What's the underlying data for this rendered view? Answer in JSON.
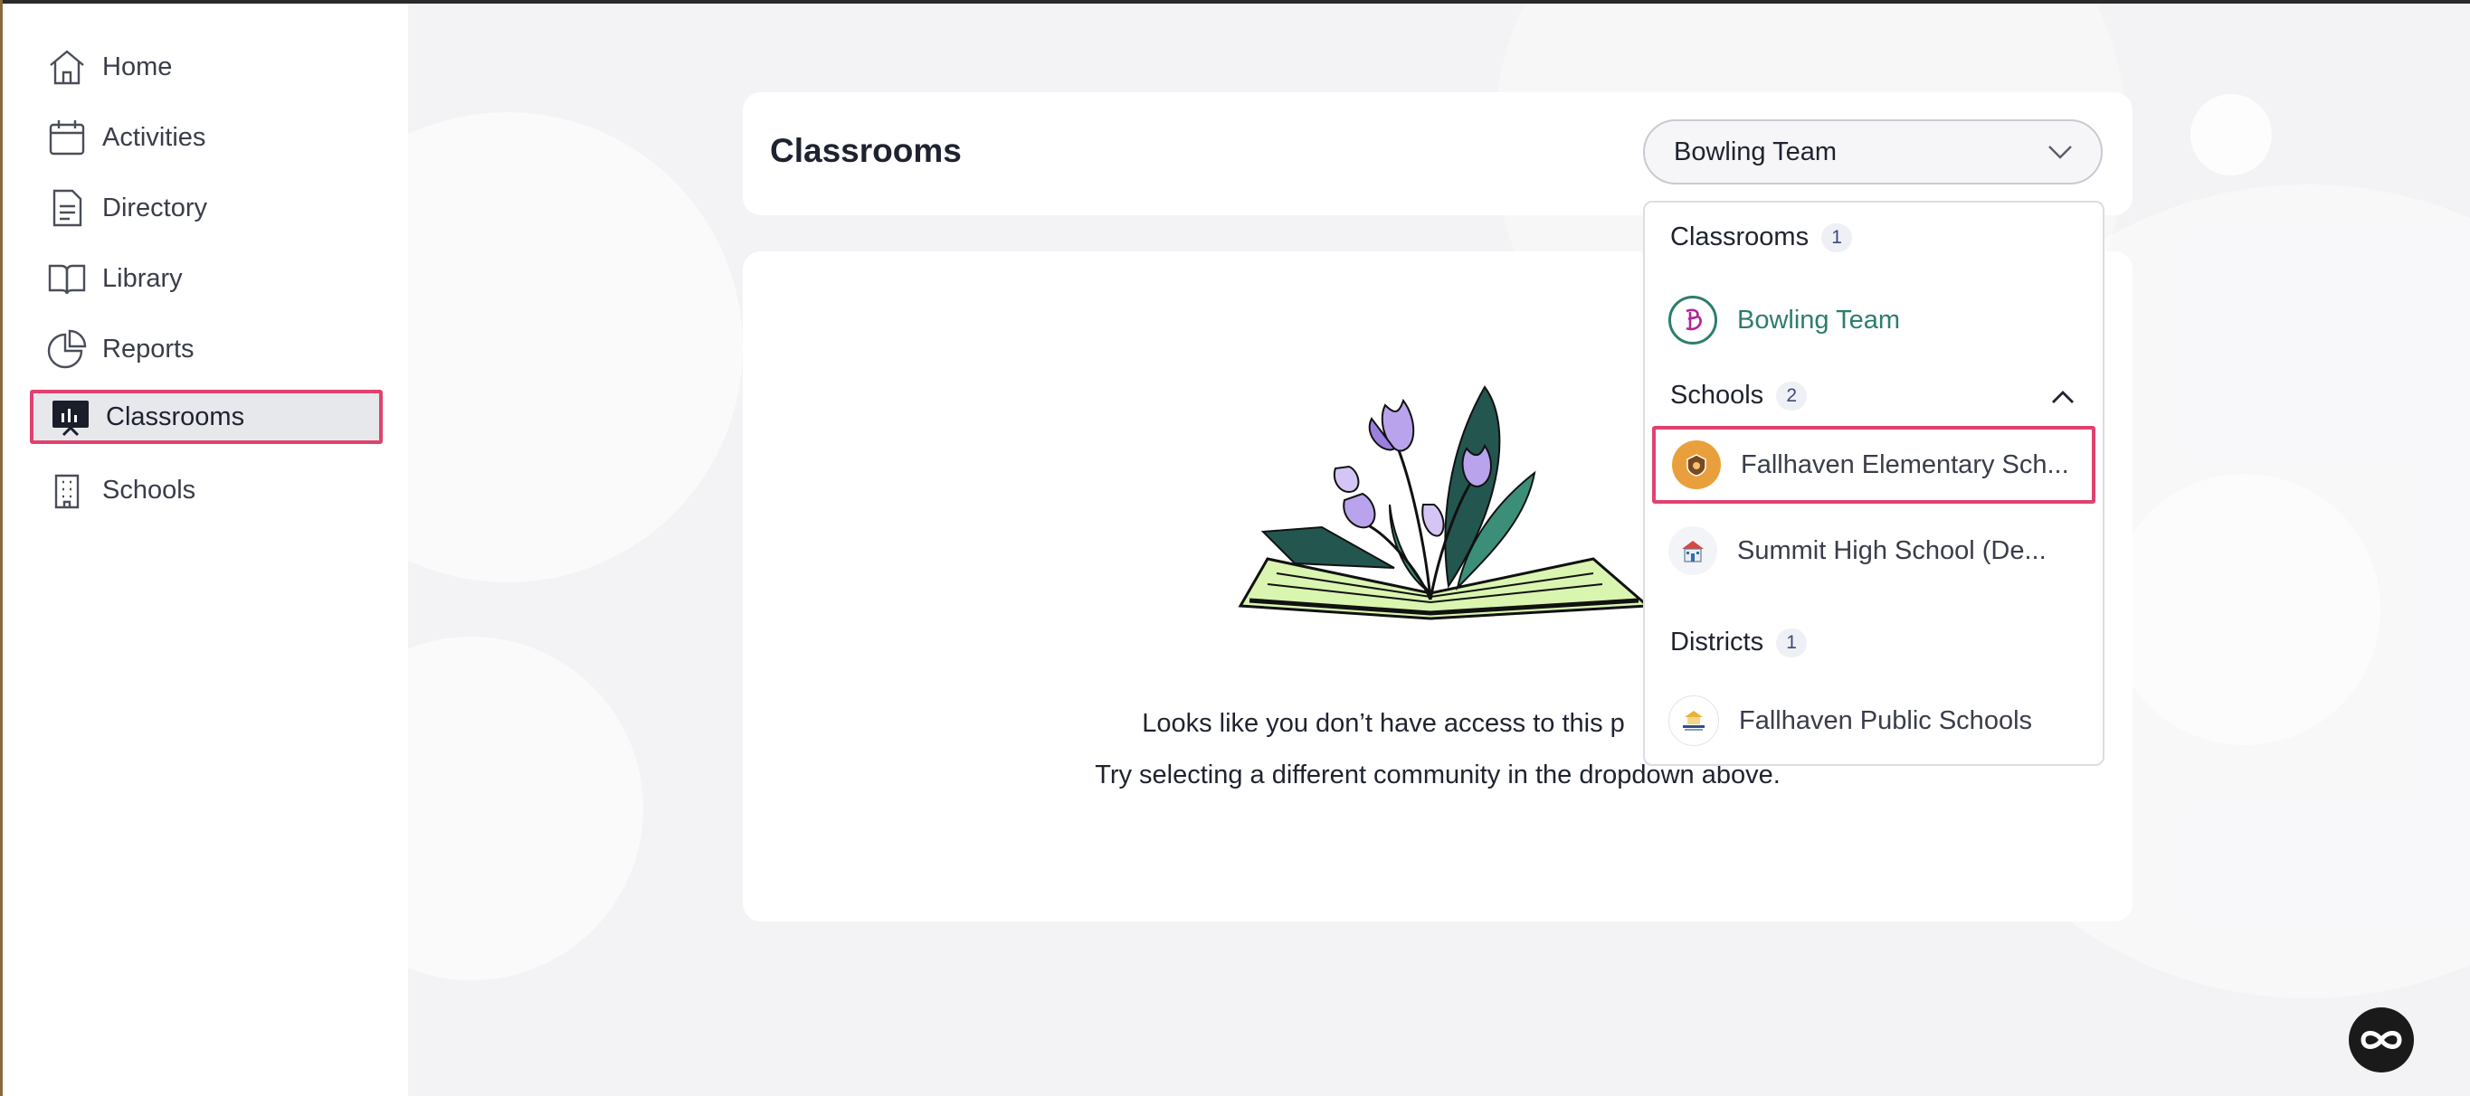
{
  "sidebar": {
    "items": [
      {
        "label": "Home",
        "icon": "home-icon"
      },
      {
        "label": "Activities",
        "icon": "calendar-icon"
      },
      {
        "label": "Directory",
        "icon": "document-icon"
      },
      {
        "label": "Library",
        "icon": "book-icon"
      },
      {
        "label": "Reports",
        "icon": "pie-chart-icon"
      },
      {
        "label": "Classrooms",
        "icon": "presentation-board-icon",
        "active": true
      },
      {
        "label": "Schools",
        "icon": "building-icon"
      }
    ]
  },
  "header": {
    "title": "Classrooms",
    "dropdown_value": "Bowling Team"
  },
  "menu": {
    "classrooms": {
      "title": "Classrooms",
      "count": "1",
      "items": [
        "Bowling Team"
      ]
    },
    "schools": {
      "title": "Schools",
      "count": "2",
      "items": [
        "Fallhaven Elementary Sch...",
        "Summit High School (De..."
      ]
    },
    "districts": {
      "title": "Districts",
      "count": "1",
      "items": [
        "Fallhaven Public Schools"
      ]
    }
  },
  "content": {
    "message_line1": "Looks like you don’t have access to this p",
    "message_line2": "Try selecting a different community in the dropdown above."
  },
  "colors": {
    "accent_highlight": "#e0426e",
    "selected_text": "#2d7e6c",
    "avatar_b": "#b0249a"
  }
}
